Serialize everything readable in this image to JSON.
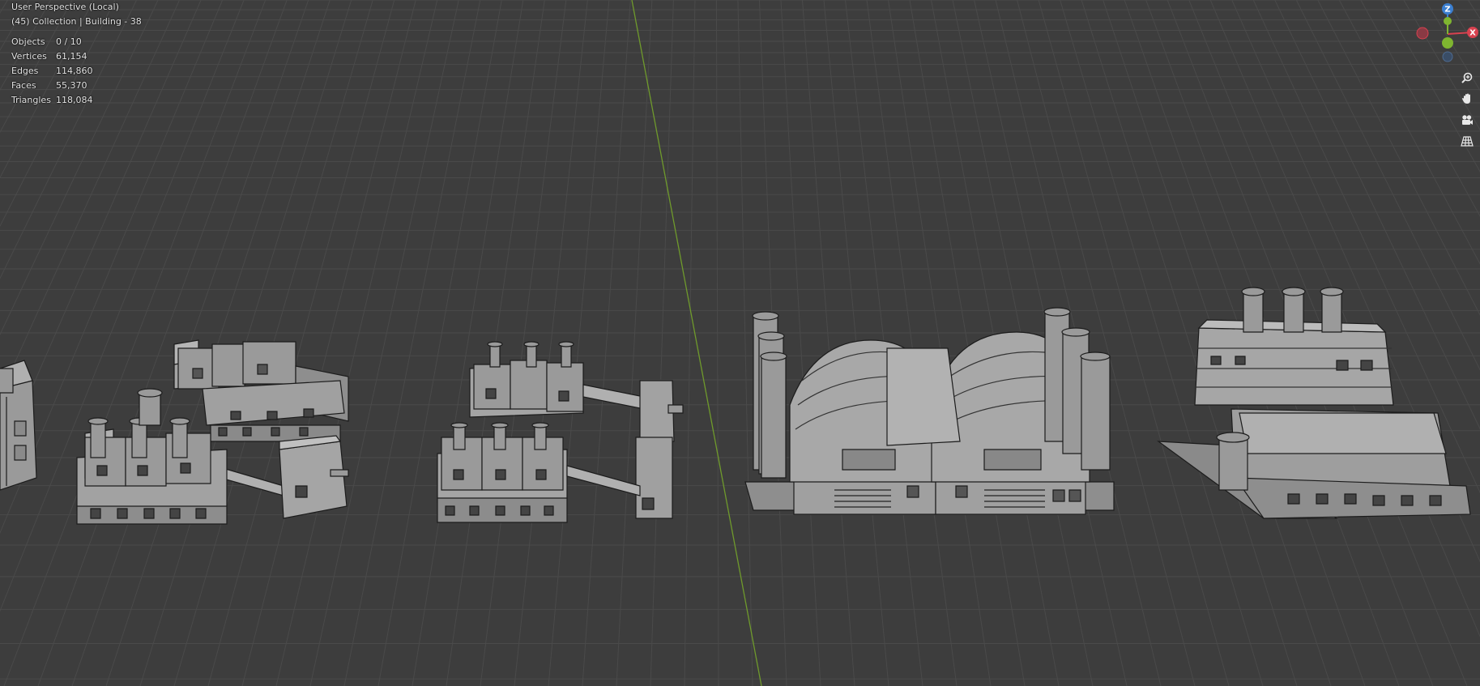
{
  "viewport": {
    "header_line1": "User Perspective (Local)",
    "header_line2": "(45) Collection | Building - 38"
  },
  "stats": [
    {
      "label": "Objects",
      "value": "0 / 10"
    },
    {
      "label": "Vertices",
      "value": "61,154"
    },
    {
      "label": "Edges",
      "value": "114,860"
    },
    {
      "label": "Faces",
      "value": "55,370"
    },
    {
      "label": "Triangles",
      "value": "118,084"
    }
  ],
  "gizmo": {
    "z_label": "Z",
    "x_label": "X",
    "colors": {
      "x": "#d8414f",
      "y": "#7fb530",
      "z": "#3b7fd1",
      "neg": "#4d6a8f"
    }
  },
  "nav_tools": [
    {
      "name": "zoom-icon"
    },
    {
      "name": "pan-hand-icon"
    },
    {
      "name": "camera-icon"
    },
    {
      "name": "ortho-grid-icon"
    }
  ],
  "colors": {
    "background": "#3d3d3d",
    "grid": "#4a4a4a",
    "y_axis": "#6f9a2c",
    "mesh_fill": "#9b9b9b",
    "mesh_wire": "#1a1a1a"
  }
}
